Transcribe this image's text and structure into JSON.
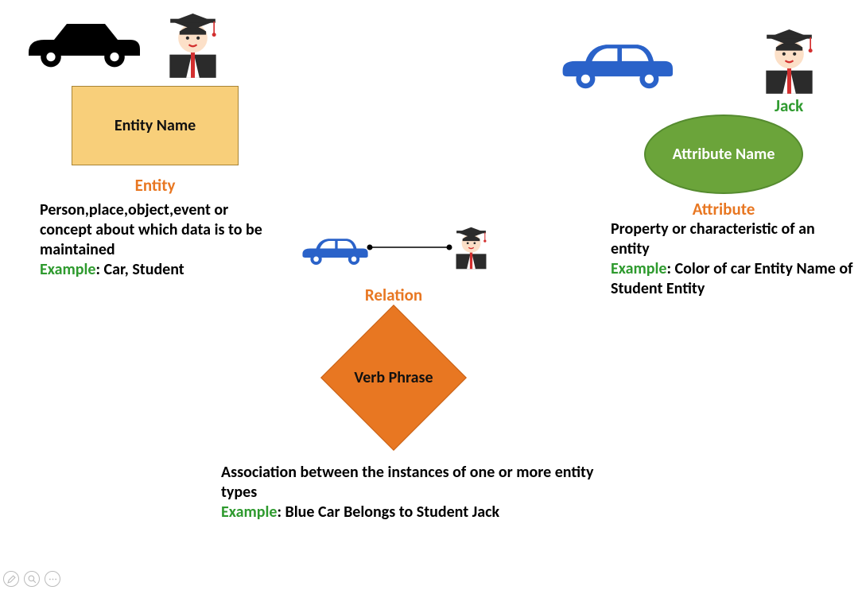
{
  "entity": {
    "shape_text": "Entity Name",
    "title": "Entity",
    "description": "Person,place,object,event or concept about which data is to be maintained",
    "example_label": "Example",
    "example_text": ": Car, Student"
  },
  "attribute": {
    "shape_text": "Attribute Name",
    "title": "Attribute",
    "student_name": "Jack",
    "description": "Property or characteristic of an entity",
    "example_label": "Example",
    "example_text": ": Color of car Entity Name of Student Entity"
  },
  "relation": {
    "shape_text": "Verb Phrase",
    "title": "Relation",
    "description": "Association between the instances of one or more entity types",
    "example_label": "Example",
    "example_text": ": Blue Car Belongs to Student Jack"
  },
  "icons": {
    "car_black": "car-icon",
    "car_blue": "car-icon",
    "student": "student-icon",
    "pen": "pen-icon",
    "magnifier": "magnifier-icon",
    "more": "more-icon"
  }
}
